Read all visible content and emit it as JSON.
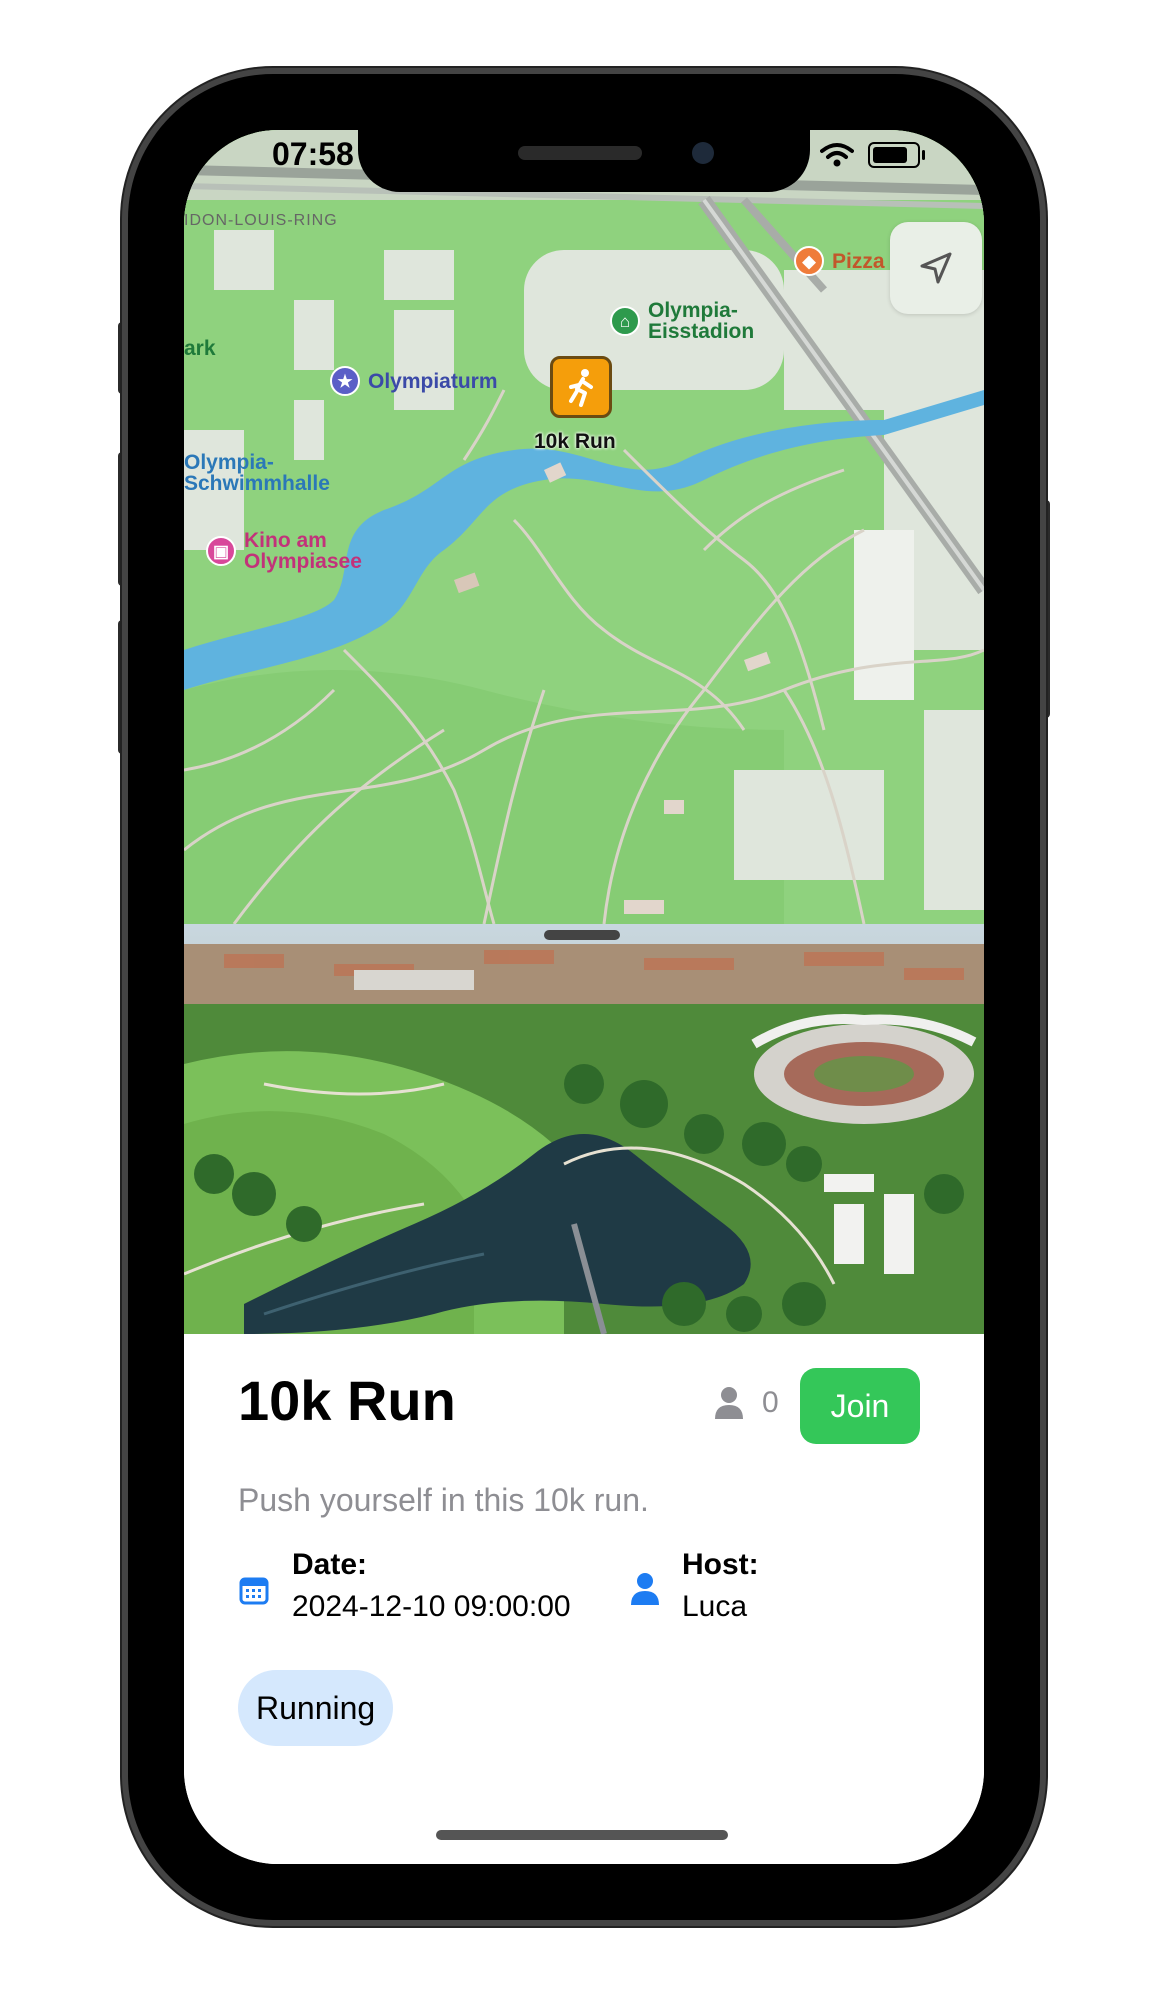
{
  "status_bar": {
    "time": "07:58"
  },
  "map": {
    "road_labels": [
      "IDON-LOUIS-RING"
    ],
    "pois": {
      "olympiaturm": "Olympiaturm",
      "eisstadion": "Olympia-\nEisstadion",
      "schwimmhalle": "Olympia-\nSchwimmhalle",
      "kino": "Kino am\nOlympiasee",
      "pizza": "Pizza",
      "park": "ark"
    },
    "event_pin_label": "10k Run"
  },
  "event": {
    "title": "10k Run",
    "participants_count": "0",
    "join_label": "Join",
    "description": "Push yourself in this 10k run.",
    "date_label": "Date:",
    "date_value": "2024-12-10 09:00:00",
    "host_label": "Host:",
    "host_value": "Luca",
    "category_tag": "Running"
  },
  "colors": {
    "join_button": "#34c759",
    "pin": "#f59e0b",
    "tag_bg": "#d5e8fd",
    "map_green": "#8fd27e",
    "water": "#5fb3df"
  }
}
